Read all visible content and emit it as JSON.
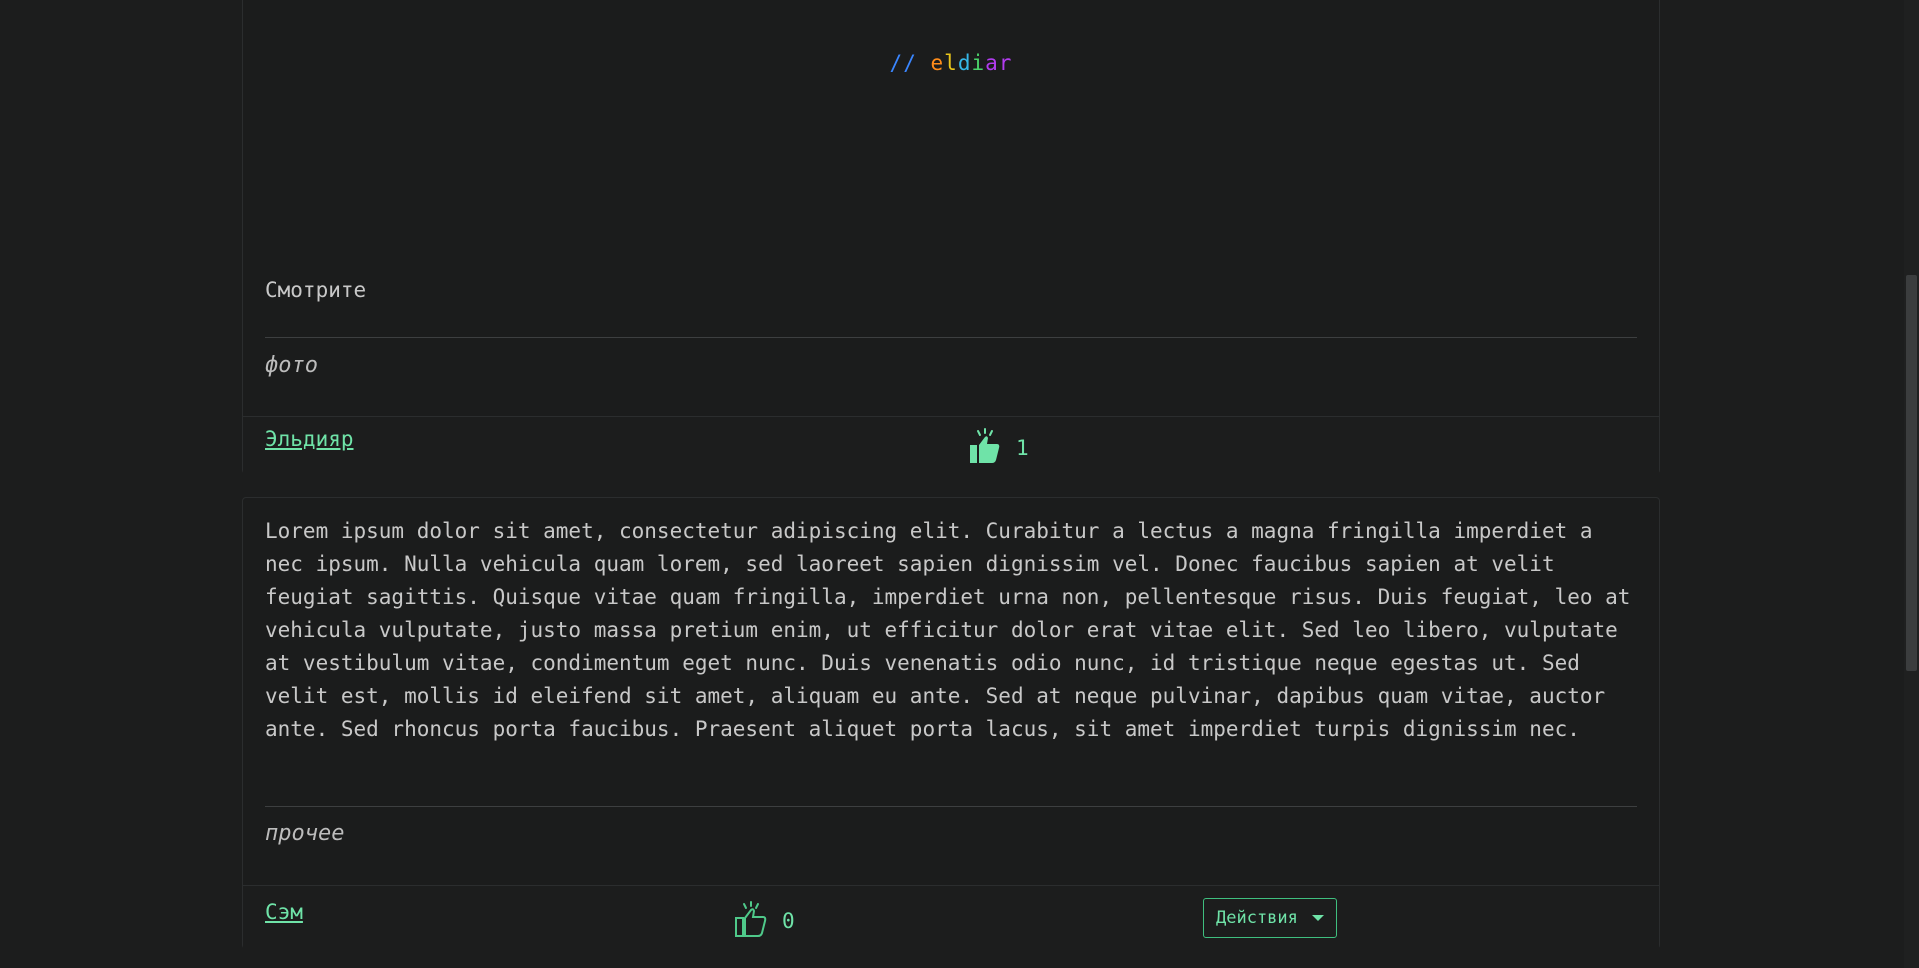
{
  "posts": [
    {
      "image_logo": {
        "slashes": "//",
        "letters": [
          "e",
          "l",
          "d",
          "i",
          "a",
          "r"
        ]
      },
      "text": "Смотрите",
      "category": "фото",
      "author": "Эльдияр",
      "likes": "1",
      "like_icon": "thumbs-up-solid-icon"
    },
    {
      "text": "Lorem ipsum dolor sit amet, consectetur adipiscing elit. Curabitur a lectus a magna fringilla imperdiet a nec ipsum. Nulla vehicula quam lorem, sed laoreet sapien dignissim vel. Donec faucibus sapien at velit feugiat sagittis. Quisque vitae quam fringilla, imperdiet urna non, pellentesque risus. Duis feugiat, leo at vehicula vulputate, justo massa pretium enim, ut efficitur dolor erat vitae elit. Sed leo libero, vulputate at vestibulum vitae, condimentum eget nunc. Duis venenatis odio nunc, id tristique neque egestas ut. Sed velit est, mollis id eleifend sit amet, aliquam eu ante. Sed at neque pulvinar, dapibus quam vitae, auctor ante. Sed rhoncus porta faucibus. Praesent aliquet porta lacus, sit amet imperdiet turpis dignissim nec.",
      "category": "прочее",
      "author": "Сэм",
      "likes": "0",
      "like_icon": "thumbs-up-outline-icon",
      "actions_label": "Действия"
    }
  ],
  "colors": {
    "background": "#1c1d1d",
    "accent": "#6fe3a8",
    "text": "#c8c8c8"
  }
}
